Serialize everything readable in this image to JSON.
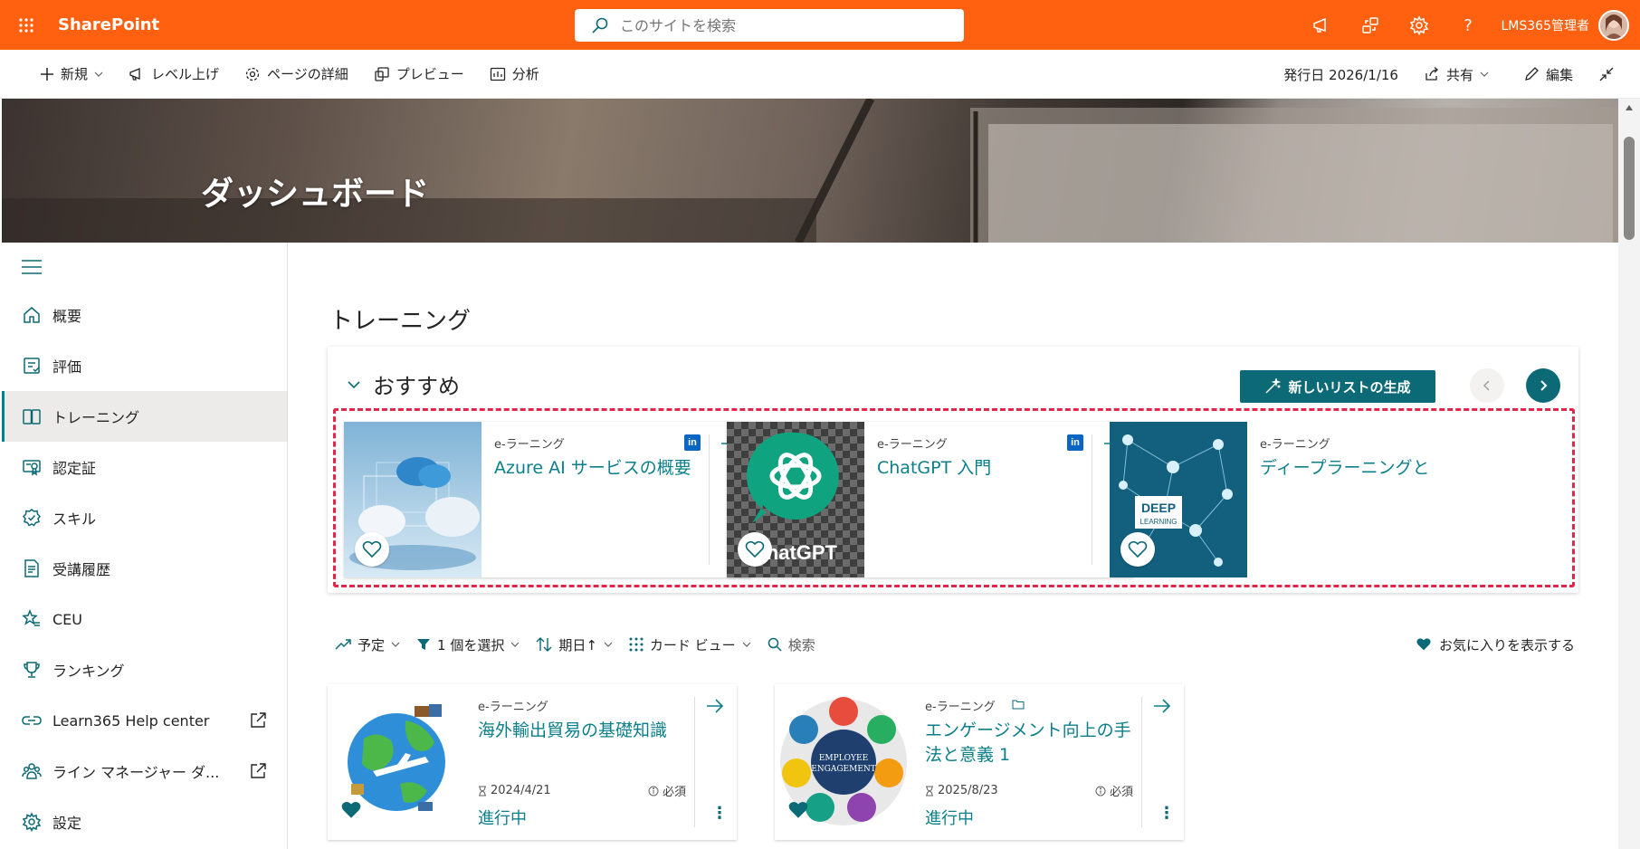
{
  "suite": {
    "app_name": "SharePoint",
    "search_placeholder": "このサイトを検索",
    "user_name": "LMS365管理者"
  },
  "command_bar": {
    "new": "新規",
    "promote": "レベル上げ",
    "page_details": "ページの詳細",
    "preview": "プレビュー",
    "analytics": "分析",
    "published": "発行日 2026/1/16",
    "share": "共有",
    "edit": "編集"
  },
  "hero": {
    "title": "ダッシュボード"
  },
  "nav": {
    "items": [
      {
        "label": "概要",
        "icon": "home-icon"
      },
      {
        "label": "評価",
        "icon": "assessment-icon"
      },
      {
        "label": "トレーニング",
        "icon": "book-icon"
      },
      {
        "label": "認定証",
        "icon": "certificate-icon"
      },
      {
        "label": "スキル",
        "icon": "badge-check-icon"
      },
      {
        "label": "受講履歴",
        "icon": "document-icon"
      },
      {
        "label": "CEU",
        "icon": "star-list-icon"
      },
      {
        "label": "ランキング",
        "icon": "trophy-icon"
      },
      {
        "label": "Learn365 Help center",
        "icon": "link-icon"
      },
      {
        "label": "ライン マネージャー ダ...",
        "icon": "people-icon"
      },
      {
        "label": "設定",
        "icon": "gear-icon"
      }
    ]
  },
  "main": {
    "section_title": "トレーニング",
    "recommended": {
      "heading": "おすすめ",
      "generate_button": "新しいリストの生成",
      "cards": [
        {
          "type": "e-ラーニング",
          "title": "Azure AI サービスの概要"
        },
        {
          "type": "e-ラーニング",
          "title": "ChatGPT 入門",
          "image_text": "hatGPT"
        },
        {
          "type": "e-ラーニング",
          "title": "ディープラーニングと",
          "image_text_1": "DEEP",
          "image_text_2": "LEARNING"
        }
      ]
    },
    "filters": {
      "upcoming": "予定",
      "selected": "1 個を選択",
      "due_date": "期日↑",
      "card_view": "カード ビュー",
      "search": "検索",
      "show_favorites": "お気に入りを表示する"
    },
    "courses": [
      {
        "type": "e-ラーニング",
        "title": "海外輸出貿易の基礎知識",
        "date": "2024/4/21",
        "required": "必須",
        "status": "進行中"
      },
      {
        "type": "e-ラーニング",
        "title": "エンゲージメント向上の手法と意義 1",
        "date": "2025/8/23",
        "required": "必須",
        "status": "進行中",
        "image_text_1": "EMPLOYEE",
        "image_text_2": "ENGAGEMENT"
      }
    ]
  },
  "colors": {
    "suite": "#ff6110",
    "accent": "#0b6a75",
    "link": "#0b7f8a",
    "highlight": "#e0264a"
  }
}
